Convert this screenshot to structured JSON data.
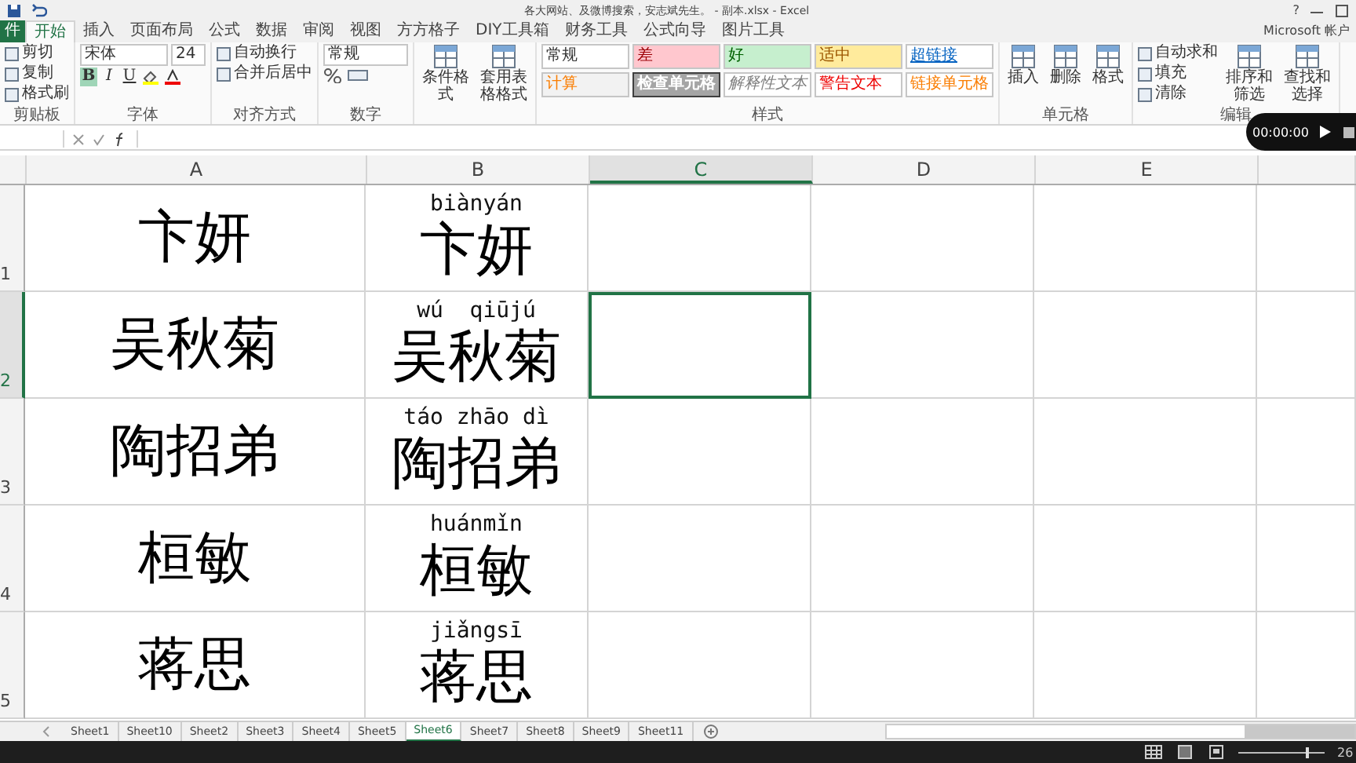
{
  "window": {
    "title": "各大网站、及微博搜索，安志斌先生。 - 副本.xlsx - Excel",
    "help": "?",
    "account": "Microsoft 帐户"
  },
  "ribbon_tabs": [
    {
      "label": "件",
      "selected": false
    },
    {
      "label": "开始",
      "selected": true
    },
    {
      "label": "插入",
      "selected": false
    },
    {
      "label": "页面布局",
      "selected": false
    },
    {
      "label": "公式",
      "selected": false
    },
    {
      "label": "数据",
      "selected": false
    },
    {
      "label": "审阅",
      "selected": false
    },
    {
      "label": "视图",
      "selected": false
    },
    {
      "label": "方方格子",
      "selected": false
    },
    {
      "label": "DIY工具箱",
      "selected": false
    },
    {
      "label": "财务工具",
      "selected": false
    },
    {
      "label": "公式向导",
      "selected": false
    },
    {
      "label": "图片工具",
      "selected": false
    }
  ],
  "ribbon_groups": [
    {
      "label": "剪贴板",
      "kind": "list",
      "items": [
        "剪切",
        "复制",
        "格式刷"
      ]
    },
    {
      "label": "字体",
      "kind": "font",
      "font": "宋体",
      "size": "24",
      "buttons": [
        "B",
        "I",
        "U"
      ]
    },
    {
      "label": "对齐方式",
      "kind": "list",
      "items": [
        "自动换行",
        "合并后居中"
      ]
    },
    {
      "label": "数字",
      "kind": "number",
      "format": "常规"
    },
    {
      "kind": "large",
      "items": [
        "条件格式",
        "套用表格格式"
      ]
    },
    {
      "label": "样式",
      "kind": "styles",
      "styles": [
        {
          "label": "常规",
          "color": "#ffffff"
        },
        {
          "label": "差",
          "color": "#ffc7ce"
        },
        {
          "label": "好",
          "color": "#c6efce"
        },
        {
          "label": "适中",
          "color": "#ffeb9c"
        },
        {
          "label": "超链接",
          "color": "#ffffff"
        },
        {
          "label": "计算",
          "color": "#f2f2f2"
        },
        {
          "label": "检查单元格",
          "color": "#a5a5a5"
        },
        {
          "label": "解释性文本",
          "color": "#ffffff"
        },
        {
          "label": "警告文本",
          "color": "#ffffff"
        },
        {
          "label": "链接单元格",
          "color": "#ffffff"
        }
      ]
    },
    {
      "label": "单元格",
      "kind": "large",
      "items": [
        "插入",
        "删除",
        "格式"
      ]
    },
    {
      "label": "编辑",
      "kind": "editing",
      "items": [
        "自动求和",
        "填充",
        "清除"
      ],
      "large": [
        "排序和筛选",
        "查找和选择"
      ]
    }
  ],
  "columns": [
    {
      "label": "A",
      "selected": false
    },
    {
      "label": "B",
      "selected": false
    },
    {
      "label": "C",
      "selected": true
    },
    {
      "label": "D",
      "selected": false
    },
    {
      "label": "E",
      "selected": false
    }
  ],
  "rows": [
    {
      "number": "1",
      "selected": false,
      "column_a": "卞妍",
      "column_b": {
        "pinyin": "biànyán",
        "text": "卞妍"
      }
    },
    {
      "number": "2",
      "selected": true,
      "column_a": "吴秋菊",
      "column_b": {
        "pinyin": "wú  qiūjú",
        "text": "吴秋菊"
      }
    },
    {
      "number": "3",
      "selected": false,
      "column_a": "陶招弟",
      "column_b": {
        "pinyin": "táo zhāo dì",
        "text": "陶招弟"
      }
    },
    {
      "number": "4",
      "selected": false,
      "column_a": "桓敏",
      "column_b": {
        "pinyin": "huánmǐn",
        "text": "桓敏"
      }
    },
    {
      "number": "5",
      "selected": false,
      "column_a": "蒋思",
      "column_b": {
        "pinyin": "jiǎngsī",
        "text": "蒋思"
      }
    }
  ],
  "sheets": [
    {
      "label": "Sheet1",
      "selected": false
    },
    {
      "label": "Sheet10",
      "selected": false
    },
    {
      "label": "Sheet2",
      "selected": false
    },
    {
      "label": "Sheet3",
      "selected": false
    },
    {
      "label": "Sheet4",
      "selected": false
    },
    {
      "label": "Sheet5",
      "selected": false
    },
    {
      "label": "Sheet6",
      "selected": true
    },
    {
      "label": "Sheet7",
      "selected": false
    },
    {
      "label": "Sheet8",
      "selected": false
    },
    {
      "label": "Sheet9",
      "selected": false
    },
    {
      "label": "Sheet11",
      "selected": false
    }
  ],
  "status_bar": {
    "zoom": {
      "level": 0.78,
      "reading": "26"
    }
  },
  "video_player": {
    "time": "00:00:00"
  }
}
